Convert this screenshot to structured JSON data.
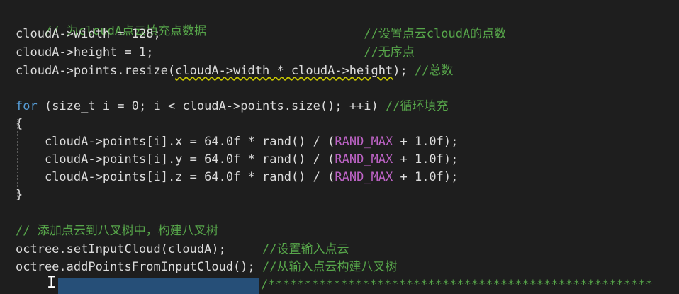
{
  "editor": {
    "lines": [
      {
        "code": "",
        "comment": "// 为cloudA点云填充点数据"
      },
      {
        "code": "cloudA->width = 128;",
        "pad": "                            ",
        "comment": "//设置点云cloudA的点数"
      },
      {
        "code": "cloudA->height = 1;",
        "pad": "                             ",
        "comment": "//无序点"
      },
      {
        "code_a": "cloudA->points.resize(",
        "code_b": "cloudA->width * cloudA->height",
        "code_c": "); ",
        "comment": "//总数"
      },
      {
        "kw": "for",
        "code": " (size_t i = 0; i < cloudA->points.size(); ++i) ",
        "comment": "//循环填充"
      },
      {
        "code": "{"
      },
      {
        "indent": "    ",
        "code_a": "cloudA->points[i].x = 64.0f * rand() / (",
        "macro": "RAND_MAX",
        "code_b": " + 1.0f);"
      },
      {
        "indent": "    ",
        "code_a": "cloudA->points[i].y = 64.0f * rand() / (",
        "macro": "RAND_MAX",
        "code_b": " + 1.0f);"
      },
      {
        "indent": "    ",
        "code_a": "cloudA->points[i].z = 64.0f * rand() / (",
        "macro": "RAND_MAX",
        "code_b": " + 1.0f);"
      },
      {
        "code": "}"
      },
      {
        "code": "",
        "comment": "// 添加点云到八叉树中，构建八叉树"
      },
      {
        "code": "octree.setInputCloud(cloudA);",
        "pad": "     ",
        "comment": "//设置输入点云"
      },
      {
        "code": "octree.addPointsFromInputCloud(); ",
        "comment": "//从输入点云构建八叉树"
      },
      {
        "comment": "/*****************************************************"
      }
    ],
    "cursor_icon": "text-cursor-icon",
    "colors": {
      "background": "#1e1e1e",
      "comment": "#57a64a",
      "keyword": "#569cd6",
      "macro": "#bd63c5",
      "selection": "#264f78"
    }
  }
}
